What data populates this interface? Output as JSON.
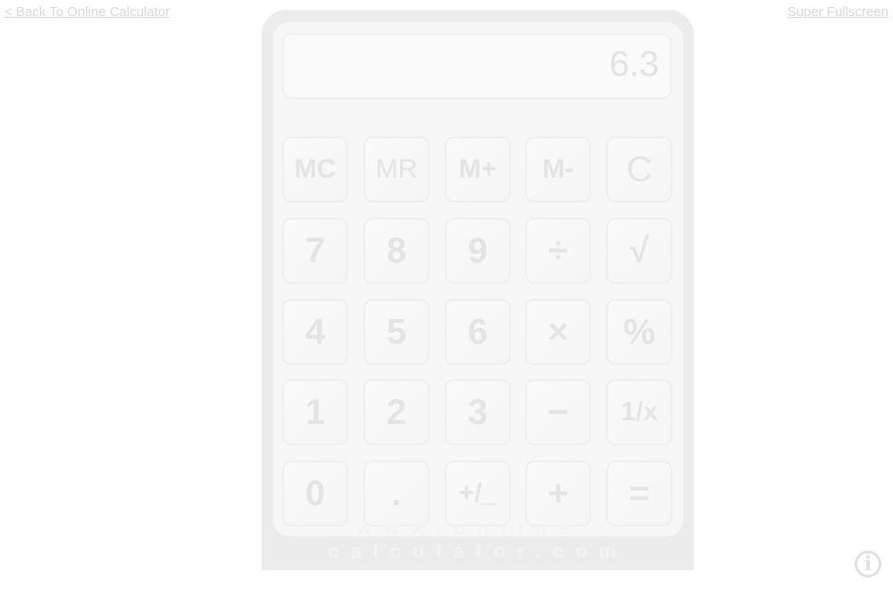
{
  "links": {
    "back": "< Back To Online Calculator",
    "fullscreen": "Super Fullscreen"
  },
  "display": "6.3",
  "buttons": [
    [
      "MC",
      "MR",
      "M+",
      "M-",
      "C"
    ],
    [
      "7",
      "8",
      "9",
      "÷",
      "√"
    ],
    [
      "4",
      "5",
      "6",
      "×",
      "%"
    ],
    [
      "1",
      "2",
      "3",
      "−",
      "1/x"
    ],
    [
      "0",
      ".",
      "+/_",
      "+",
      "="
    ]
  ],
  "brand": "www.online-calculator.com",
  "info_icon": "i"
}
